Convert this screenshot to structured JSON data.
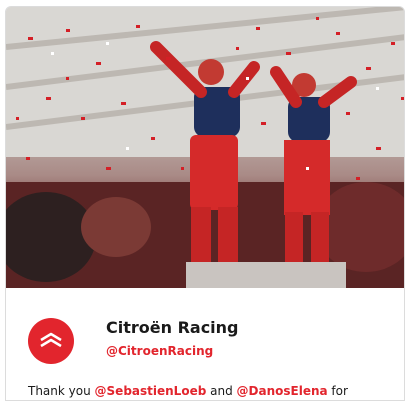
{
  "account": {
    "name": "Citroën Racing",
    "handle": "@CitroenRacing",
    "avatar_color": "#e2252d"
  },
  "tweet": {
    "prefix": "Thank you ",
    "mention_1": "@SebastienLoeb",
    "middle": " and ",
    "mention_2": "@DanosElena",
    "suffix": " for"
  },
  "media": {
    "icon": "rally-celebration-photo"
  },
  "colors": {
    "accent": "#e2252d",
    "text": "#1a1a1a"
  }
}
